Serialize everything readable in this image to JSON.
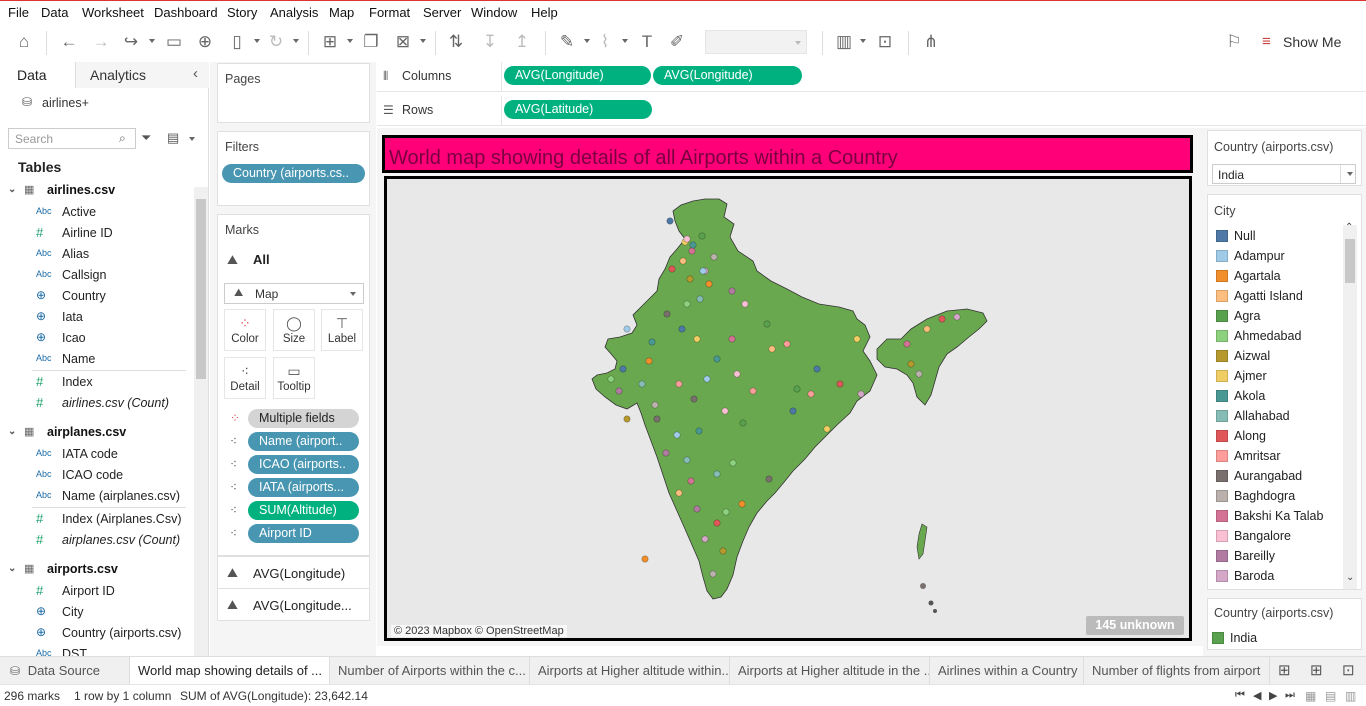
{
  "menu": [
    "File",
    "Data",
    "Worksheet",
    "Dashboard",
    "Story",
    "Analysis",
    "Map",
    "Format",
    "Server",
    "Window",
    "Help"
  ],
  "toolbar": {
    "show_me_label": "Show Me"
  },
  "left_pane": {
    "tab_data": "Data",
    "tab_analytics": "Analytics",
    "datasource": "airlines+",
    "search_placeholder": "Search",
    "tables_heading": "Tables",
    "tables": [
      {
        "name": "airlines.csv",
        "fields": [
          {
            "type": "Abc",
            "name": "Active"
          },
          {
            "type": "#",
            "name": "Airline ID"
          },
          {
            "type": "Abc",
            "name": "Alias"
          },
          {
            "type": "Abc",
            "name": "Callsign"
          },
          {
            "type": "geo",
            "name": "Country"
          },
          {
            "type": "geo",
            "name": "Iata"
          },
          {
            "type": "geo",
            "name": "Icao"
          },
          {
            "type": "Abc",
            "name": "Name"
          },
          {
            "type": "#",
            "name": "Index"
          },
          {
            "type": "#",
            "name": "airlines.csv (Count)"
          }
        ]
      },
      {
        "name": "airplanes.csv",
        "fields": [
          {
            "type": "Abc",
            "name": "IATA code"
          },
          {
            "type": "Abc",
            "name": "ICAO code"
          },
          {
            "type": "Abc",
            "name": "Name (airplanes.csv)"
          },
          {
            "type": "#",
            "name": "Index (Airplanes.Csv)"
          },
          {
            "type": "#",
            "name": "airplanes.csv (Count)"
          }
        ]
      },
      {
        "name": "airports.csv",
        "fields": [
          {
            "type": "#",
            "name": "Airport ID"
          },
          {
            "type": "geo",
            "name": "City"
          },
          {
            "type": "geo",
            "name": "Country (airports.csv)"
          },
          {
            "type": "Abc",
            "name": "DST"
          }
        ]
      }
    ]
  },
  "pages": {
    "title": "Pages"
  },
  "filters": {
    "title": "Filters",
    "pill": "Country (airports.cs.."
  },
  "marks": {
    "title": "Marks",
    "all_label": "All",
    "mark_type": "Map",
    "buttons": [
      "Color",
      "Size",
      "Label",
      "Detail",
      "Tooltip"
    ],
    "pills": [
      {
        "label": "Multiple fields",
        "style": "grey"
      },
      {
        "label": "Name (airport..",
        "style": "blue"
      },
      {
        "label": "ICAO (airports..",
        "style": "blue"
      },
      {
        "label": "IATA (airports...",
        "style": "blue"
      },
      {
        "label": "SUM(Altitude)",
        "style": "green"
      },
      {
        "label": "Airport ID",
        "style": "blue"
      }
    ],
    "sub_cards": [
      "AVG(Longitude)",
      "AVG(Longitude..."
    ]
  },
  "shelves": {
    "columns_label": "Columns",
    "columns_pills": [
      "AVG(Longitude)",
      "AVG(Longitude)"
    ],
    "rows_label": "Rows",
    "rows_pills": [
      "AVG(Latitude)"
    ]
  },
  "view": {
    "title": "World map showing details of all Airports within a Country",
    "title_bg": "#ff0078",
    "map_fill": "#6aa84f",
    "attribution": "© 2023 Mapbox © OpenStreetMap",
    "unknown_badge": "145 unknown"
  },
  "right_pane": {
    "filter_title": "Country (airports.csv)",
    "filter_value": "India",
    "legend_title": "City",
    "legend": [
      {
        "name": "Null",
        "color": "#4e79a7"
      },
      {
        "name": "Adampur",
        "color": "#a0cbe8"
      },
      {
        "name": "Agartala",
        "color": "#f28e2b"
      },
      {
        "name": "Agatti Island",
        "color": "#ffbe7d"
      },
      {
        "name": "Agra",
        "color": "#59a14f"
      },
      {
        "name": "Ahmedabad",
        "color": "#8cd17d"
      },
      {
        "name": "Aizwal",
        "color": "#b6992d"
      },
      {
        "name": "Ajmer",
        "color": "#f1ce63"
      },
      {
        "name": "Akola",
        "color": "#499894"
      },
      {
        "name": "Allahabad",
        "color": "#86bcb6"
      },
      {
        "name": "Along",
        "color": "#e15759"
      },
      {
        "name": "Amritsar",
        "color": "#ff9d9a"
      },
      {
        "name": "Aurangabad",
        "color": "#79706e"
      },
      {
        "name": "Baghdogra",
        "color": "#bab0ac"
      },
      {
        "name": "Bakshi Ka Talab",
        "color": "#d37295"
      },
      {
        "name": "Bangalore",
        "color": "#fabfd2"
      },
      {
        "name": "Bareilly",
        "color": "#b07aa1"
      },
      {
        "name": "Baroda",
        "color": "#d4a6c8"
      }
    ],
    "country_legend_title": "Country (airports.csv)",
    "country_legend": [
      {
        "name": "India",
        "color": "#59a14f"
      }
    ]
  },
  "sheet_tabs": {
    "data_source": "Data Source",
    "tabs": [
      "World map showing details of ...",
      "Number of Airports within the c...",
      "Airports at Higher altitude within...",
      "Airports at Higher altitude in the ...",
      "Airlines within a Country",
      "Number of flights from airport"
    ]
  },
  "status": {
    "marks": "296 marks",
    "rows_cols": "1 row by 1 column",
    "sum": "SUM of AVG(Longitude): 23,642.14"
  }
}
